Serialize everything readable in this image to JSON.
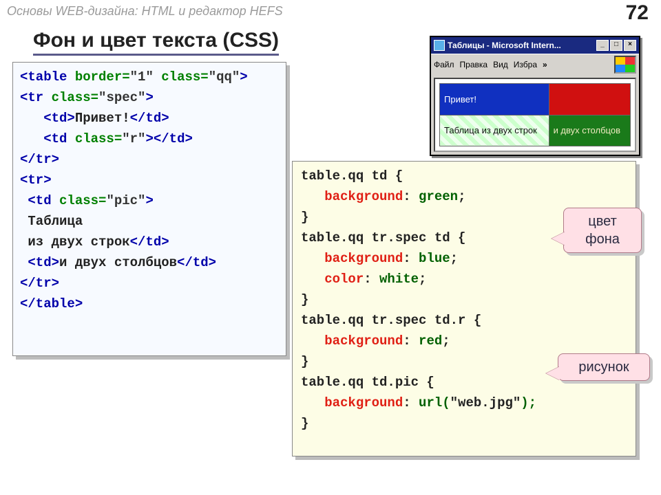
{
  "header": {
    "course": "Основы WEB-дизайна: HTML и редактор HEFS",
    "page_number": "72",
    "title": "Фон и цвет текста (CSS)"
  },
  "html_code": {
    "l1a": "<table",
    "l1b": " border=",
    "l1c": "\"1\"",
    "l1d": " class=",
    "l1e": "\"qq\"",
    "l1f": ">",
    "l2a": "<tr",
    "l2b": " class=",
    "l2c": "\"spec\"",
    "l2d": ">",
    "l3a": "   <td>",
    "l3b": "Привет!",
    "l3c": "</td>",
    "l4a": "   <td",
    "l4b": " class=",
    "l4c": "\"r\"",
    "l4d": "></td>",
    "l5": "</tr>",
    "l6": "<tr>",
    "l7a": " <td",
    "l7b": " class=",
    "l7c": "\"pic\"",
    "l7d": ">",
    "l8": " Таблица",
    "l9a": " из двух строк",
    "l9b": "</td>",
    "l10a": " <td>",
    "l10b": "и двух столбцов",
    "l10c": "</td>",
    "l11": "</tr>",
    "l12": "</table>"
  },
  "css_code": {
    "s1": "table.qq td {",
    "p1a": "   background",
    "p1b": ": ",
    "p1c": "green",
    "p1d": ";",
    "c1": "}",
    "s2": "table.qq tr.spec td {",
    "p2a": "   background",
    "p2b": ": ",
    "p2c": "blue",
    "p2d": ";",
    "p3a": "   color",
    "p3b": ": ",
    "p3c": "white",
    "p3d": ";",
    "c2": "}",
    "s3": "table.qq tr.spec td.r {",
    "p4a": "   background",
    "p4b": ": ",
    "p4c": "red",
    "p4d": ";",
    "c3": "}",
    "s4": "table.qq td.pic {",
    "p5a": "   background",
    "p5b": ": ",
    "p5c": "url(",
    "p5d": "\"web.jpg\"",
    "p5e": ");",
    "c4": "}"
  },
  "browser": {
    "title": "Таблицы - Microsoft Intern...",
    "menu": {
      "file": "Файл",
      "edit": "Правка",
      "view": "Вид",
      "fav": "Избра",
      "chev": "»"
    },
    "cells": {
      "c1": "Привет!",
      "c2": "",
      "c3": "Таблица из двух строк",
      "c4": "и двух столбцов"
    },
    "buttons": {
      "min": "_",
      "max": "□",
      "close": "×"
    }
  },
  "callouts": {
    "a_line1": "цвет",
    "a_line2": "фона",
    "b": "рисунок"
  }
}
